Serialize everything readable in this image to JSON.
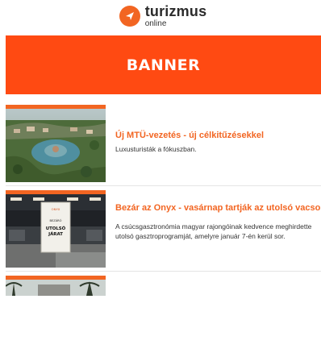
{
  "logo": {
    "name": "turizmus",
    "sub": "online"
  },
  "banner": {
    "label": "BANNER"
  },
  "articles": [
    {
      "title": "Új MTÜ-vezetés - új célkitűzésekkel",
      "description": "Luxusturisták a fókuszban."
    },
    {
      "title": "Bezár az Onyx - vasárnap tartják az utolsó vacsorát",
      "description": "A csúcsgasztronómia magyar rajongóinak kedvence meghirdette utolsó gasztroprogramját, amelyre január 7-én kerül sor."
    },
    {
      "title": ""
    }
  ],
  "billboard": {
    "brand": "ONYX",
    "line1": "BEZÁRÓ",
    "line2": "UTOLSÓ",
    "line3": "JÁRAT"
  },
  "colors": {
    "accent": "#f26522",
    "banner": "#ff4a12"
  }
}
